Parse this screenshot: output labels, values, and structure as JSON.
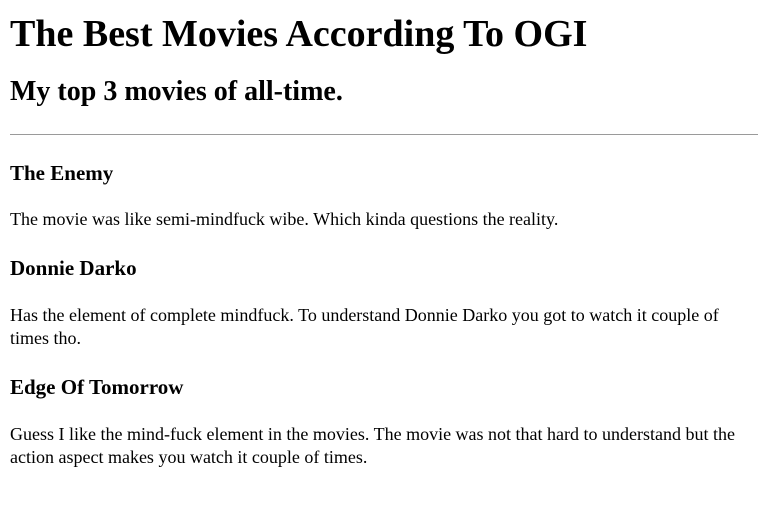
{
  "page": {
    "title": "The Best Movies According To OGI",
    "subtitle": "My top 3 movies of all-time."
  },
  "movies": [
    {
      "title": "The Enemy",
      "description": "The movie was like semi-mindfuck wibe. Which kinda questions the reality."
    },
    {
      "title": "Donnie Darko",
      "description": "Has the element of complete mindfuck. To understand Donnie Darko you got to watch it couple of times tho."
    },
    {
      "title": "Edge Of Tomorrow",
      "description": "Guess I like the mind-fuck element in the movies. The movie was not that hard to understand but the action aspect makes you watch it couple of times."
    }
  ]
}
